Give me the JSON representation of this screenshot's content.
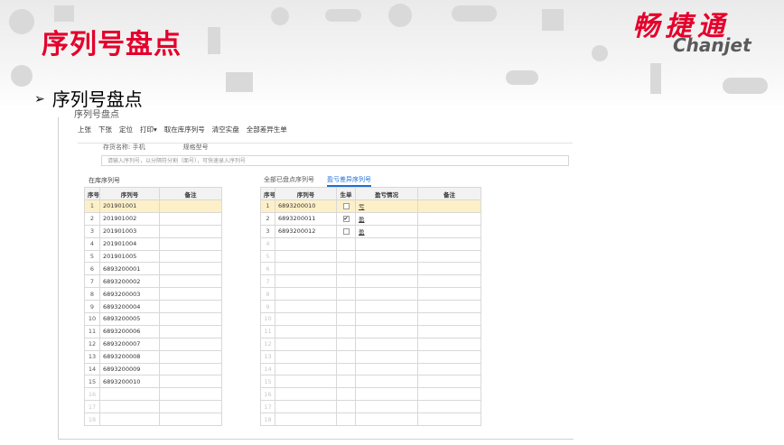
{
  "slide": {
    "title": "序列号盘点",
    "logo_cn": "畅捷通",
    "logo_en": "Chanjet",
    "bullet_arrow": "➢",
    "bullet_text": "序列号盘点"
  },
  "app": {
    "title": "序列号盘点",
    "toolbar": [
      "上张",
      "下张",
      "定位",
      "打印▾",
      "取在库序列号",
      "清空实盘",
      "全部差异生单"
    ],
    "fields": {
      "inventory_label": "存货名称: 手机",
      "spec_label": "规格型号"
    },
    "scan_placeholder": "请输入序列号，以分隔符分割（面号），可快速录入序列号",
    "left_section_label": "在库序列号",
    "right_tabs": [
      "全部已盘点序列号",
      "盈亏差异序列号"
    ],
    "left_table": {
      "columns": [
        "序号",
        "序列号",
        "备注"
      ],
      "rows": [
        {
          "no": "1",
          "serial": "201901001"
        },
        {
          "no": "2",
          "serial": "201901002"
        },
        {
          "no": "3",
          "serial": "201901003"
        },
        {
          "no": "4",
          "serial": "201901004"
        },
        {
          "no": "5",
          "serial": "201901005"
        },
        {
          "no": "6",
          "serial": "6893200001"
        },
        {
          "no": "7",
          "serial": "6893200002"
        },
        {
          "no": "8",
          "serial": "6893200003"
        },
        {
          "no": "9",
          "serial": "6893200004"
        },
        {
          "no": "10",
          "serial": "6893200005"
        },
        {
          "no": "11",
          "serial": "6893200006"
        },
        {
          "no": "12",
          "serial": "6893200007"
        },
        {
          "no": "13",
          "serial": "6893200008"
        },
        {
          "no": "14",
          "serial": "6893200009"
        },
        {
          "no": "15",
          "serial": "6893200010"
        },
        {
          "no": "16",
          "serial": ""
        },
        {
          "no": "17",
          "serial": ""
        },
        {
          "no": "18",
          "serial": ""
        }
      ]
    },
    "right_table": {
      "columns": [
        "序号",
        "序列号",
        "生单",
        "盈亏情况",
        "备注"
      ],
      "rows": [
        {
          "no": "1",
          "serial": "6893200010",
          "checked": false,
          "status": "亏"
        },
        {
          "no": "2",
          "serial": "6893200011",
          "checked": true,
          "status": "盈"
        },
        {
          "no": "3",
          "serial": "6893200012",
          "checked": false,
          "status": "盈"
        },
        {
          "no": "4",
          "serial": "",
          "checked": null,
          "status": ""
        },
        {
          "no": "5",
          "serial": "",
          "checked": null,
          "status": ""
        },
        {
          "no": "6",
          "serial": "",
          "checked": null,
          "status": ""
        },
        {
          "no": "7",
          "serial": "",
          "checked": null,
          "status": ""
        },
        {
          "no": "8",
          "serial": "",
          "checked": null,
          "status": ""
        },
        {
          "no": "9",
          "serial": "",
          "checked": null,
          "status": ""
        },
        {
          "no": "10",
          "serial": "",
          "checked": null,
          "status": ""
        },
        {
          "no": "11",
          "serial": "",
          "checked": null,
          "status": ""
        },
        {
          "no": "12",
          "serial": "",
          "checked": null,
          "status": ""
        },
        {
          "no": "13",
          "serial": "",
          "checked": null,
          "status": ""
        },
        {
          "no": "14",
          "serial": "",
          "checked": null,
          "status": ""
        },
        {
          "no": "15",
          "serial": "",
          "checked": null,
          "status": ""
        },
        {
          "no": "16",
          "serial": "",
          "checked": null,
          "status": ""
        },
        {
          "no": "17",
          "serial": "",
          "checked": null,
          "status": ""
        },
        {
          "no": "18",
          "serial": "",
          "checked": null,
          "status": ""
        }
      ]
    }
  },
  "colors": {
    "brand_red": "#e4002b",
    "selected_row": "#fdf0c8",
    "active_tab": "#1f6fd6"
  }
}
